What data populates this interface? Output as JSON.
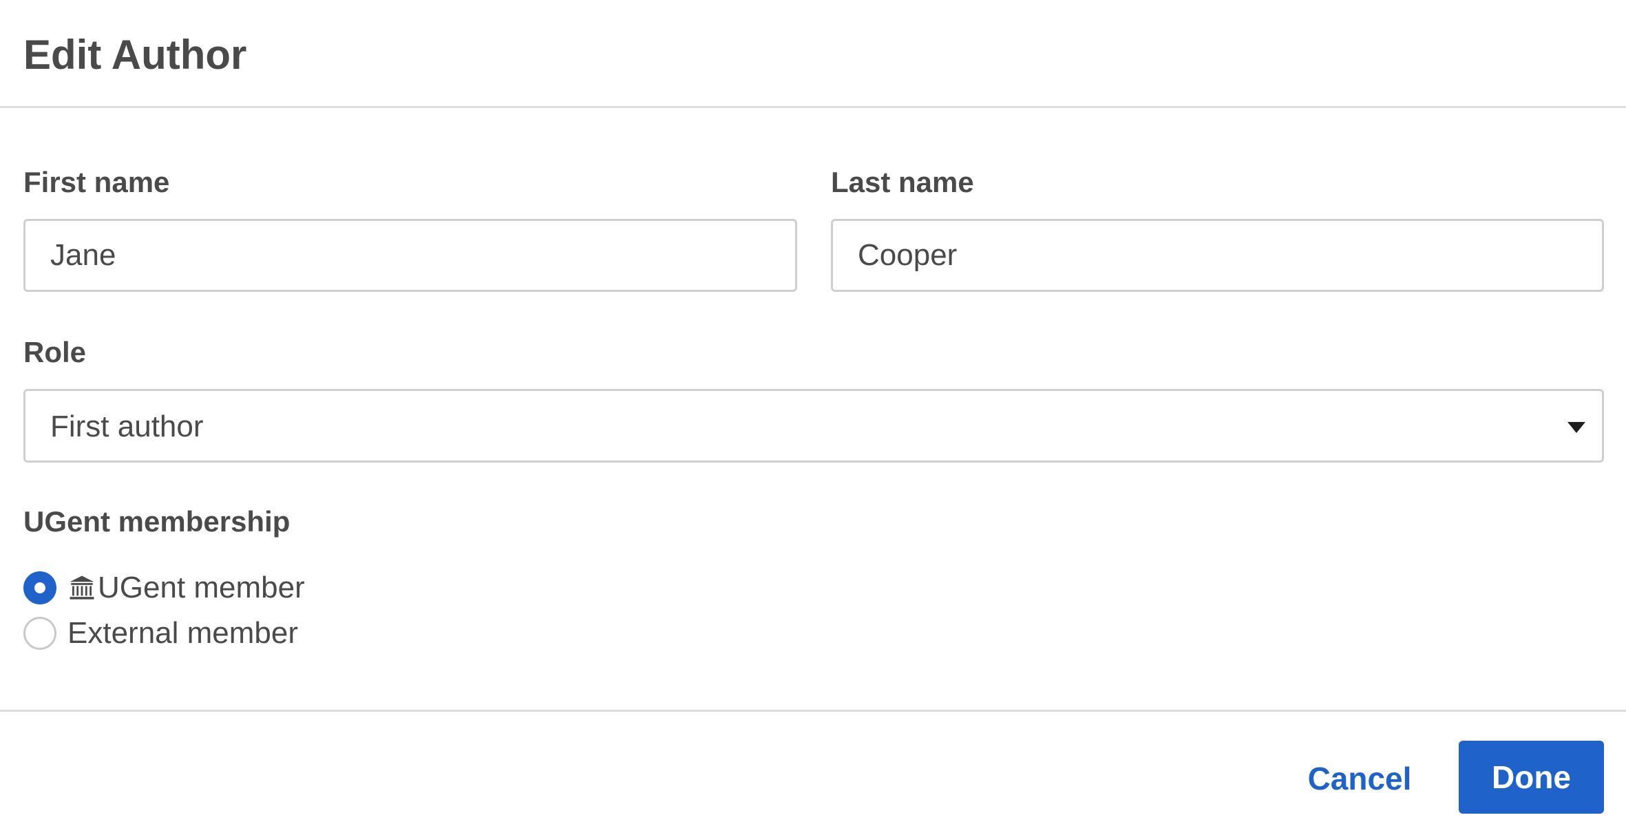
{
  "dialog": {
    "title": "Edit Author"
  },
  "form": {
    "first_name": {
      "label": "First name",
      "value": "Jane"
    },
    "last_name": {
      "label": "Last name",
      "value": "Cooper"
    },
    "role": {
      "label": "Role",
      "selected": "First author"
    },
    "membership": {
      "label": "UGent membership",
      "options": [
        {
          "label": "UGent member",
          "checked": true,
          "icon": "institution-icon"
        },
        {
          "label": "External member",
          "checked": false
        }
      ]
    }
  },
  "footer": {
    "cancel_label": "Cancel",
    "done_label": "Done"
  },
  "colors": {
    "accent": "#1f62c9",
    "text": "#4a4a4a",
    "border": "#cfcfcf"
  }
}
